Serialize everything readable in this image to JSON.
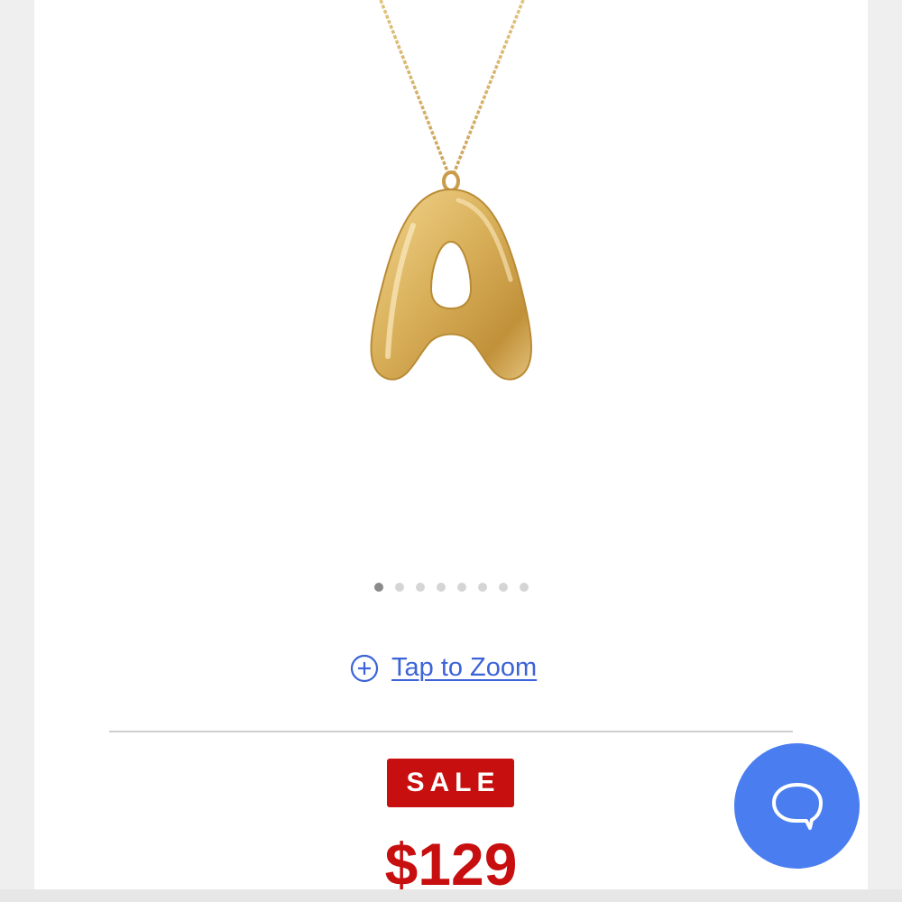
{
  "product": {
    "image_alt": "Gold bubble letter A pendant necklace"
  },
  "carousel": {
    "total_slides": 8,
    "active_index": 0
  },
  "zoom": {
    "label": "Tap to Zoom",
    "icon": "plus-circle-icon"
  },
  "pricing": {
    "badge": "SALE",
    "price": "$129"
  },
  "chat": {
    "icon": "chat-bubble-icon"
  },
  "colors": {
    "link": "#3c63d8",
    "sale": "#c80f0f",
    "chat_button": "#4a7ef0",
    "gold": "#d6ad52"
  }
}
